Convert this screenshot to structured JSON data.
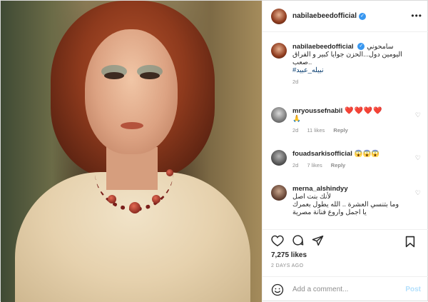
{
  "header": {
    "username": "nabilaebeedofficial",
    "more": "•••"
  },
  "caption": {
    "username": "nabilaebeedofficial",
    "line1": "سامحوني",
    "line2": "اليومين دول...الحزن جوايا كبير و الفراق",
    "line3": "..صعب",
    "hashtag": "#نبيله_عبيد",
    "time": "2d"
  },
  "comments": [
    {
      "username": "mryoussefnabil",
      "text": "❤️❤️❤️❤️",
      "extra": "🙏",
      "time": "2d",
      "likes": "11 likes",
      "reply": "Reply"
    },
    {
      "username": "fouadsarkisofficial",
      "text": "😱😱😱",
      "time": "2d",
      "likes": "7 likes",
      "reply": "Reply"
    },
    {
      "username": "merna_alshindyy",
      "line1": "لأنك بنت اصل",
      "line2": "وما بتنسي العشرة .. الله يطول بعمرك",
      "line3": "يا اجمل واروع فنانة مصرية"
    }
  ],
  "stats": {
    "likes": "7,275 likes",
    "time_ago": "2 DAYS AGO"
  },
  "composer": {
    "placeholder": "Add a comment...",
    "post_label": "Post"
  },
  "colors": {
    "verified": "#3897f0",
    "heart": "#ed4956",
    "post_disabled": "#b2dffc"
  }
}
